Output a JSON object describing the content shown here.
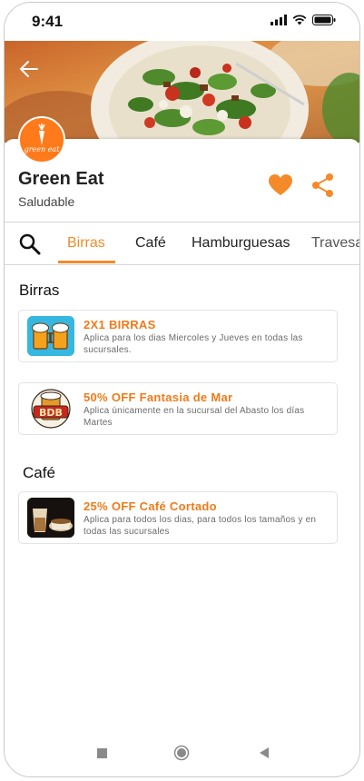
{
  "status_bar": {
    "time": "9:41"
  },
  "restaurant": {
    "name": "Green Eat",
    "category": "Saludable",
    "logo_text": "green eat"
  },
  "tabs": [
    {
      "label": "Birras",
      "active": true
    },
    {
      "label": "Café",
      "active": false
    },
    {
      "label": "Hamburguesas",
      "active": false
    },
    {
      "label": "Travesa",
      "active": false
    }
  ],
  "sections": [
    {
      "title": "Birras",
      "offers": [
        {
          "title": "2X1 BIRRAS",
          "description": "Aplica para los dias Miercoles y Jueves en todas las sucursales.",
          "image": "beer-mugs-icon"
        },
        {
          "title": "50% OFF Fantasia de Mar",
          "description": "Aplica únicamente en la sucursal del Abasto los días Martes",
          "image": "bdb-beer-logo",
          "image_text": "BDB"
        }
      ]
    },
    {
      "title": "Café",
      "offers": [
        {
          "title": "25% OFF Café Cortado",
          "description": "Aplica para todos los dias, para todos los tamaños y en todas las sucursales",
          "image": "coffee-cups-photo"
        }
      ]
    }
  ],
  "colors": {
    "accent": "#f48a2a",
    "offer_title": "#f07a18",
    "logo_bg": "#ff7a1a"
  }
}
